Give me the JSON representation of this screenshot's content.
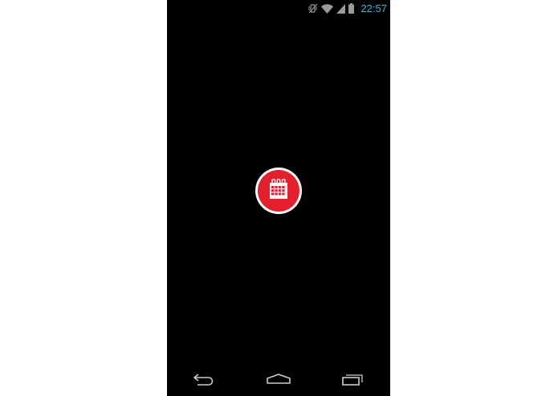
{
  "status_bar": {
    "time": "22:57",
    "icons": [
      "vibrate-icon",
      "wifi-icon",
      "signal-icon",
      "battery-icon"
    ],
    "clock_color": "#33b5e5"
  },
  "app": {
    "icon": "calendar-icon",
    "accent": "#e3202c"
  },
  "nav_bar": {
    "icons": [
      "back-icon",
      "home-icon",
      "recent-apps-icon"
    ]
  }
}
